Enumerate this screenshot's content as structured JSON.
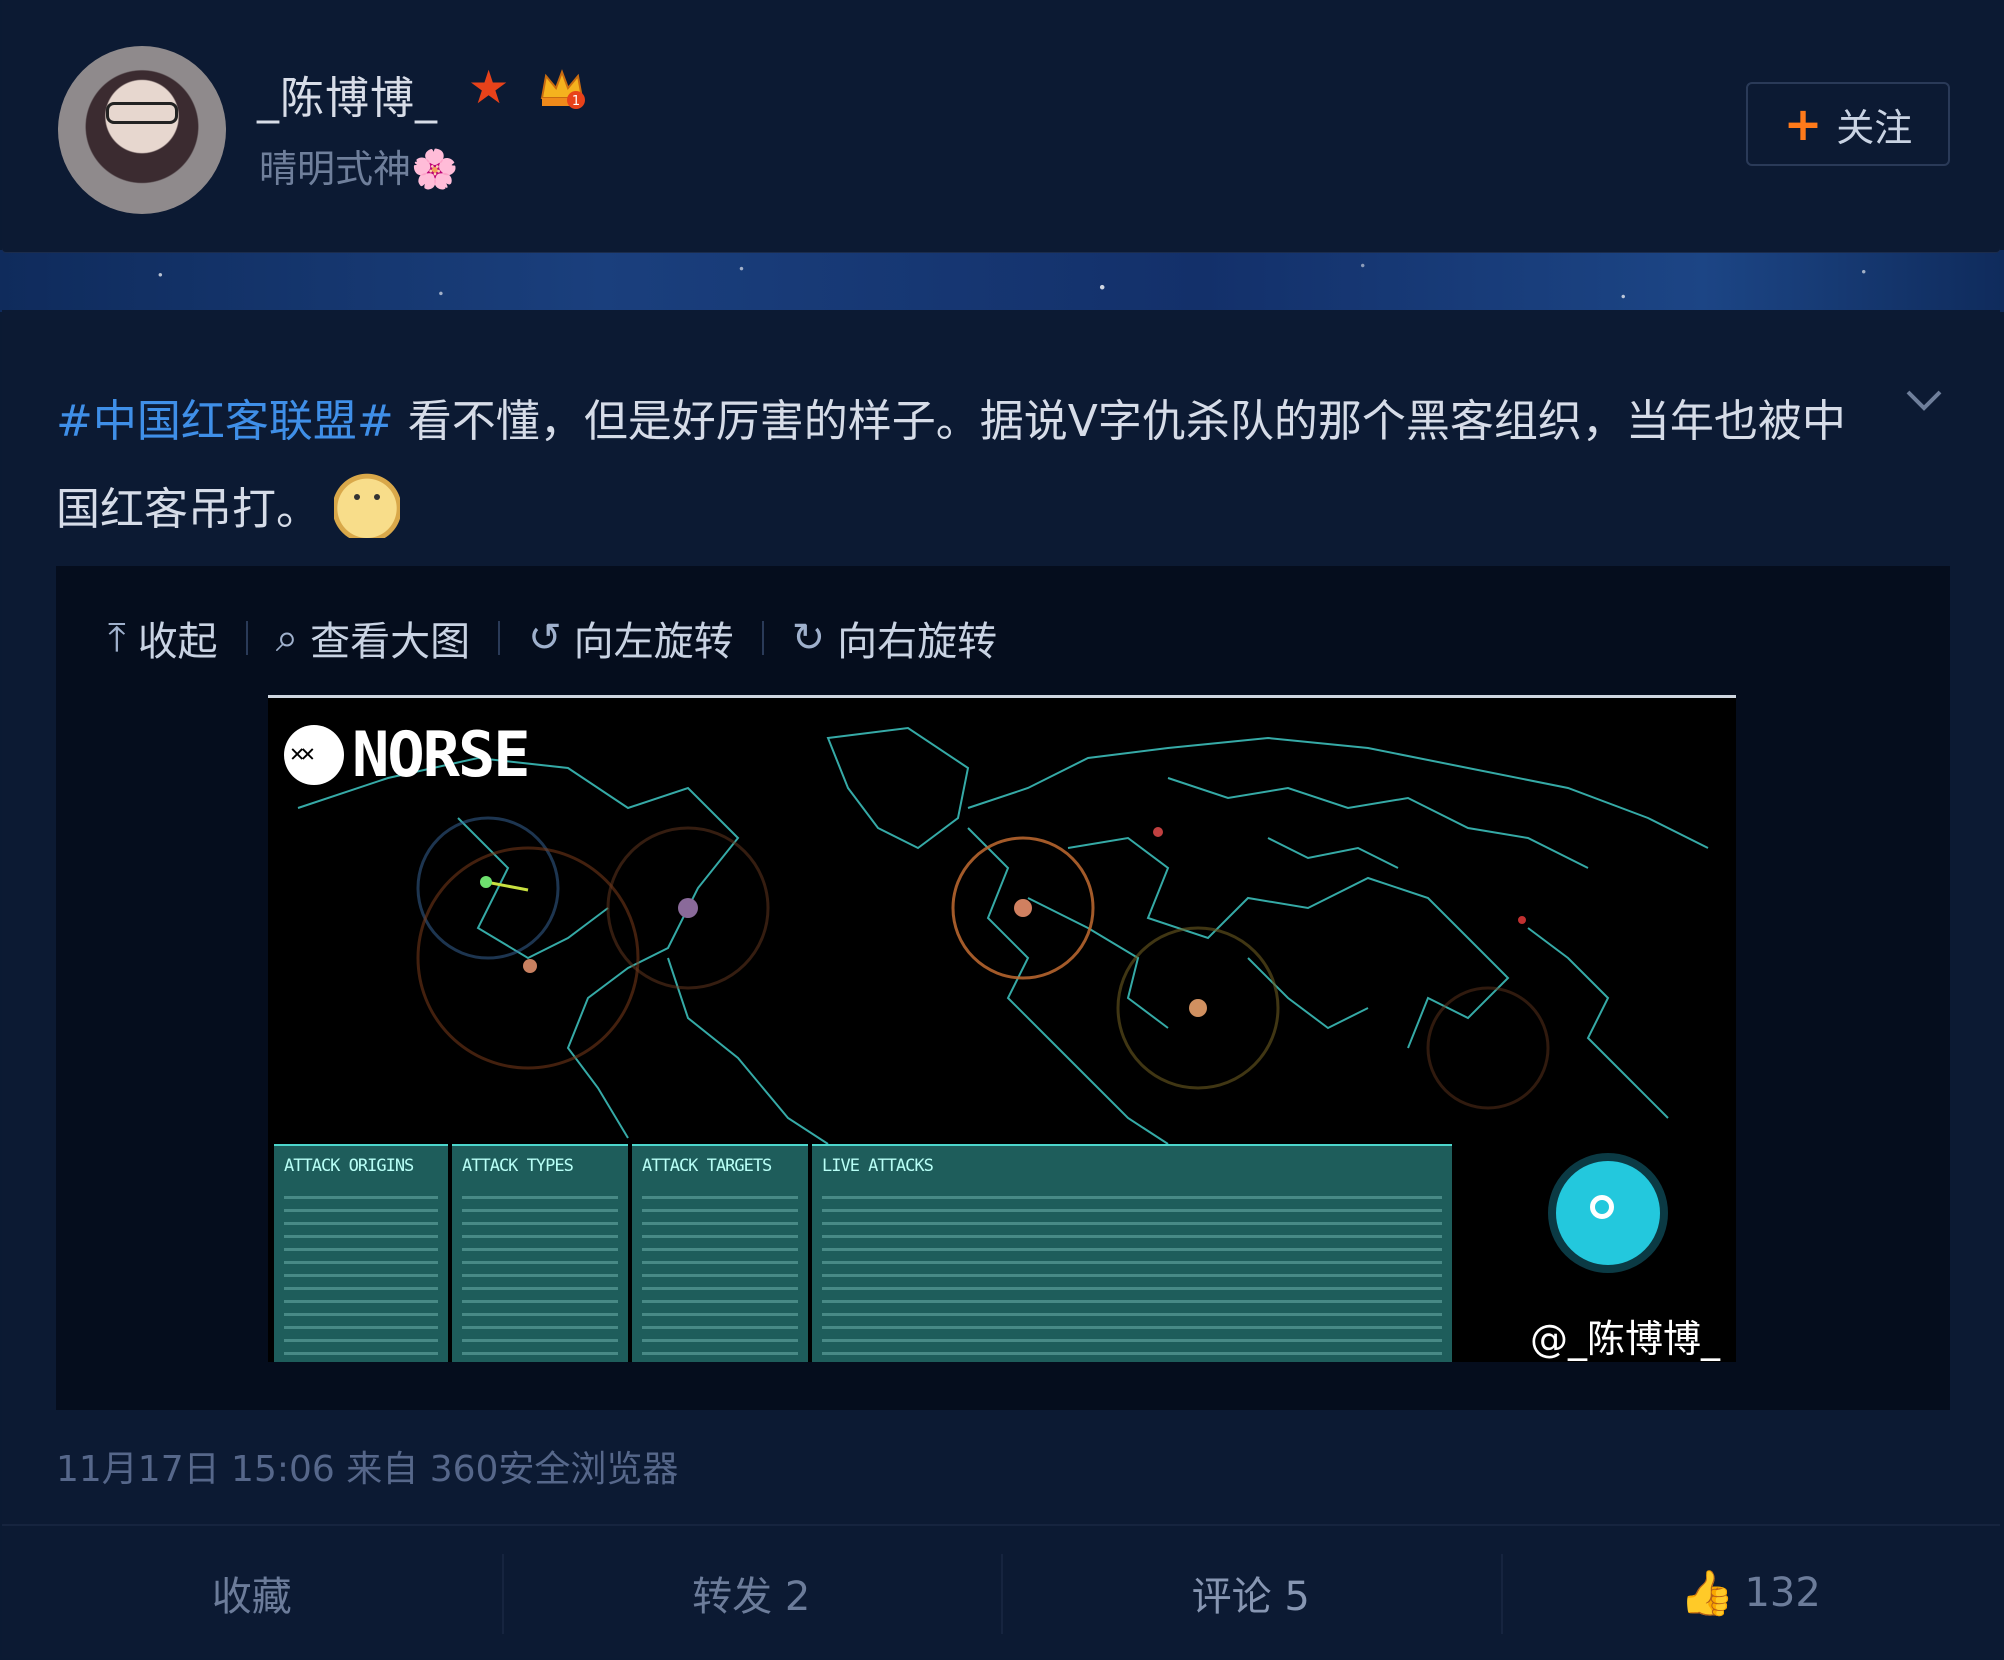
{
  "user": {
    "name": "_陈博博_",
    "subtitle": "晴明式神🌸",
    "crown_level": "1",
    "follow_label": "关注"
  },
  "post": {
    "hashtag": "#中国红客联盟#",
    "text": " 看不懂，但是好厉害的样子。据说V字仇杀队的那个黑客组织，当年也被中国红客吊打。"
  },
  "media_toolbar": {
    "collapse": "收起",
    "view_large": "查看大图",
    "rotate_left": "向左旋转",
    "rotate_right": "向右旋转"
  },
  "image": {
    "logo_text": "NORSE",
    "panels": [
      "ATTACK ORIGINS",
      "ATTACK TYPES",
      "ATTACK TARGETS",
      "LIVE ATTACKS"
    ],
    "watermark": "@_陈博博_"
  },
  "meta": "11月17日 15:06 来自 360安全浏览器",
  "actions": {
    "favorite": "收藏",
    "repost": "转发 2",
    "comment": "评论 5",
    "likes": "132"
  },
  "colors": {
    "background": "#0b1a33",
    "hashtag": "#3f8fe8",
    "follow_plus": "#ff7a1a",
    "map_lines": "#3fc8c4"
  }
}
